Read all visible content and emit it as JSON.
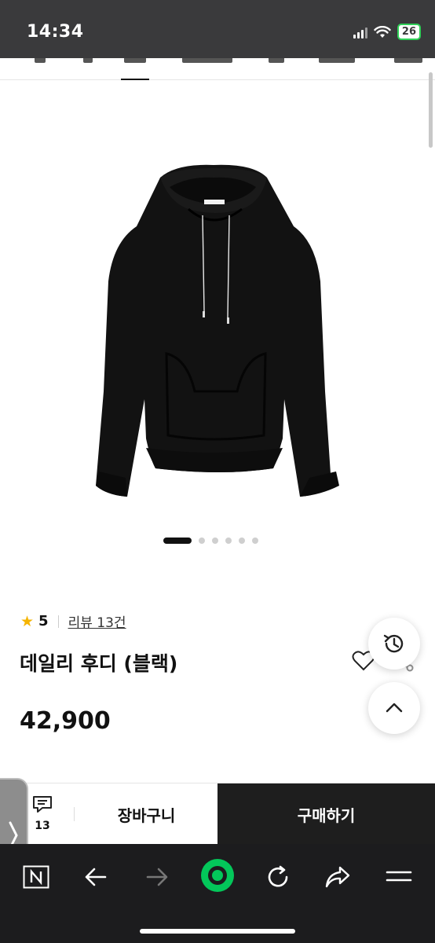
{
  "status_bar": {
    "time": "14:34",
    "battery": "26"
  },
  "product": {
    "rating": "5",
    "review_link": "리뷰 13건",
    "title": "데일리 후디 (블랙)",
    "price": "42,900",
    "image_count": 6,
    "active_image_index": 0
  },
  "buy_bar": {
    "qna_count": "13",
    "cart_label": "장바구니",
    "buy_label": "구매하기"
  },
  "icons": {
    "star": "star-icon",
    "wishlist": "heart-icon",
    "share": "share-icon",
    "history": "history-icon",
    "scroll_top": "chevron-up-icon",
    "qna": "chat-icon",
    "side": "chevron-right-icon",
    "nav": [
      "naver-n-icon",
      "back-arrow-icon",
      "forward-arrow-icon",
      "green-dot-home-icon",
      "reload-icon",
      "share-arrow-icon",
      "menu-icon"
    ]
  },
  "colors": {
    "star": "#f5b400",
    "buy_button": "#1e1e1e",
    "nav_bar": "#1c1c1e",
    "green": "#03c75a"
  }
}
